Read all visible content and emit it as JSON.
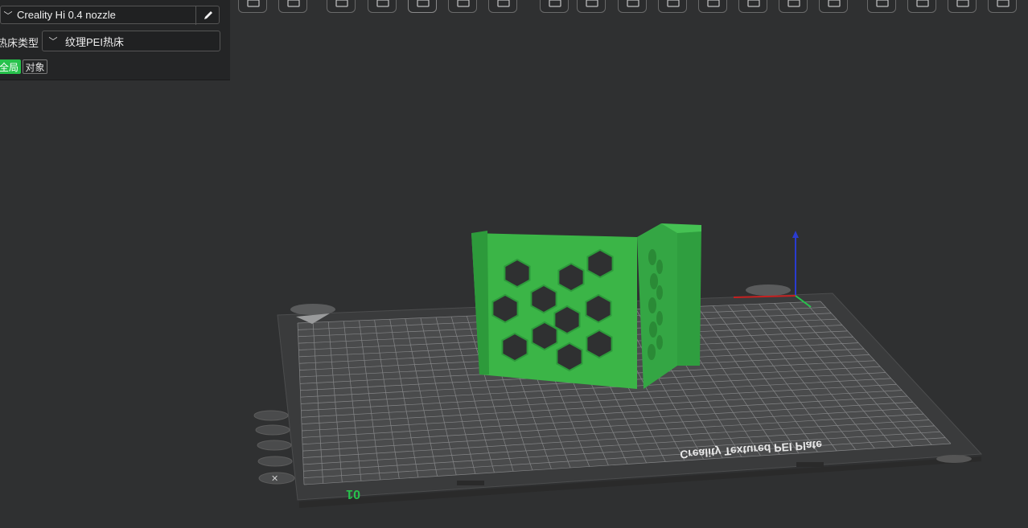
{
  "left_panel": {
    "printer": {
      "value": "Creality Hi 0.4 nozzle"
    },
    "bed_type": {
      "label": "热床类型",
      "value": "纹理PEI热床"
    },
    "scope": {
      "global_label": "全局",
      "object_label": "对象"
    }
  },
  "toolbar": {
    "items": [
      "view-cube",
      "grid",
      "add",
      "shape",
      "auto-arrange",
      "layout",
      "orient",
      "split",
      "settings",
      "measure",
      "cut",
      "support",
      "seam",
      "scale",
      "text",
      "emboss",
      "assembly",
      "variable-layer",
      "layers"
    ]
  },
  "plate": {
    "label": "Creality Textured PEI Plate",
    "number": "01"
  },
  "colors": {
    "accent": "#27c24c",
    "model": "#3bb547",
    "panel_bg": "#242526",
    "viewport_bg": "#2f3031"
  }
}
